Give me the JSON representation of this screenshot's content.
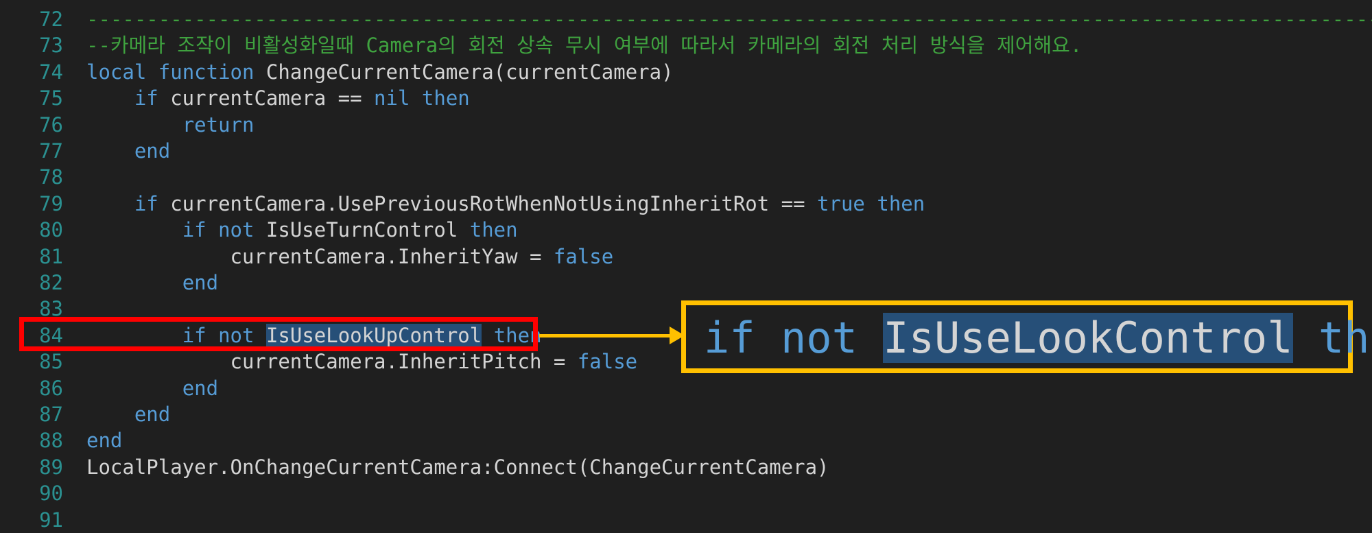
{
  "editor": {
    "lines": [
      {
        "num": "72",
        "tokens": [
          {
            "t": "--------------------------------------------------------------------------------------------------------------",
            "c": "cm"
          }
        ]
      },
      {
        "num": "73",
        "tokens": [
          {
            "t": "--카메라 조작이 비활성화일때 Camera의 회전 상속 무시 여부에 따라서 카메라의 회전 처리 방식을 제어해요.",
            "c": "cm"
          }
        ]
      },
      {
        "num": "74",
        "tokens": [
          {
            "t": "local",
            "c": "kw"
          },
          {
            "t": " ",
            "c": "tx"
          },
          {
            "t": "function",
            "c": "kw"
          },
          {
            "t": " ChangeCurrentCamera(currentCamera)",
            "c": "tx"
          }
        ]
      },
      {
        "num": "75",
        "tokens": [
          {
            "t": "    ",
            "c": "tx"
          },
          {
            "t": "if",
            "c": "kw"
          },
          {
            "t": " currentCamera == ",
            "c": "tx"
          },
          {
            "t": "nil",
            "c": "kw"
          },
          {
            "t": " ",
            "c": "tx"
          },
          {
            "t": "then",
            "c": "kw"
          }
        ]
      },
      {
        "num": "76",
        "tokens": [
          {
            "t": "        ",
            "c": "tx"
          },
          {
            "t": "return",
            "c": "kw"
          }
        ]
      },
      {
        "num": "77",
        "tokens": [
          {
            "t": "    ",
            "c": "tx"
          },
          {
            "t": "end",
            "c": "kw"
          }
        ]
      },
      {
        "num": "78",
        "tokens": []
      },
      {
        "num": "79",
        "tokens": [
          {
            "t": "    ",
            "c": "tx"
          },
          {
            "t": "if",
            "c": "kw"
          },
          {
            "t": " currentCamera.UsePreviousRotWhenNotUsingInheritRot == ",
            "c": "tx"
          },
          {
            "t": "true",
            "c": "kw"
          },
          {
            "t": " ",
            "c": "tx"
          },
          {
            "t": "then",
            "c": "kw"
          }
        ]
      },
      {
        "num": "80",
        "tokens": [
          {
            "t": "        ",
            "c": "tx"
          },
          {
            "t": "if",
            "c": "kw"
          },
          {
            "t": " ",
            "c": "tx"
          },
          {
            "t": "not",
            "c": "kw"
          },
          {
            "t": " IsUseTurnControl ",
            "c": "tx"
          },
          {
            "t": "then",
            "c": "kw"
          }
        ]
      },
      {
        "num": "81",
        "tokens": [
          {
            "t": "            currentCamera.InheritYaw = ",
            "c": "tx"
          },
          {
            "t": "false",
            "c": "kw"
          }
        ]
      },
      {
        "num": "82",
        "tokens": [
          {
            "t": "        ",
            "c": "tx"
          },
          {
            "t": "end",
            "c": "kw"
          }
        ]
      },
      {
        "num": "83",
        "tokens": []
      },
      {
        "num": "84",
        "tokens": [
          {
            "t": "        ",
            "c": "tx"
          },
          {
            "t": "if",
            "c": "kw"
          },
          {
            "t": " ",
            "c": "tx"
          },
          {
            "t": "not",
            "c": "kw"
          },
          {
            "t": " ",
            "c": "tx"
          },
          {
            "t": "IsUseLookUpControl",
            "c": "hl"
          },
          {
            "t": " ",
            "c": "tx"
          },
          {
            "t": "then",
            "c": "kw"
          }
        ]
      },
      {
        "num": "85",
        "tokens": [
          {
            "t": "            currentCamera.InheritPitch = ",
            "c": "tx"
          },
          {
            "t": "false",
            "c": "kw"
          }
        ]
      },
      {
        "num": "86",
        "tokens": [
          {
            "t": "        ",
            "c": "tx"
          },
          {
            "t": "end",
            "c": "kw"
          }
        ]
      },
      {
        "num": "87",
        "tokens": [
          {
            "t": "    ",
            "c": "tx"
          },
          {
            "t": "end",
            "c": "kw"
          }
        ]
      },
      {
        "num": "88",
        "tokens": [
          {
            "t": "end",
            "c": "kw"
          }
        ]
      },
      {
        "num": "89",
        "tokens": [
          {
            "t": "LocalPlayer.OnChangeCurrentCamera:Connect(ChangeCurrentCamera)",
            "c": "tx"
          }
        ]
      },
      {
        "num": "90",
        "tokens": []
      },
      {
        "num": "91",
        "tokens": []
      }
    ]
  },
  "callout": {
    "tokens": [
      {
        "t": "if",
        "c": "kw"
      },
      {
        "t": " ",
        "c": "tx"
      },
      {
        "t": "not",
        "c": "kw"
      },
      {
        "t": " ",
        "c": "tx"
      },
      {
        "t": "IsUseLookControl",
        "c": "hl"
      },
      {
        "t": " ",
        "c": "tx"
      },
      {
        "t": "then",
        "c": "kw"
      }
    ],
    "highlight_color": "#ff0000",
    "zoom_border_color": "#ffc000",
    "arrow_color": "#ffc000"
  },
  "theme": {
    "background": "#1f1f1f",
    "keyword": "#569cd6",
    "text": "#d4d4d4",
    "comment": "#3fa23f",
    "line_number": "#2b9191",
    "selection": "#264f78"
  }
}
